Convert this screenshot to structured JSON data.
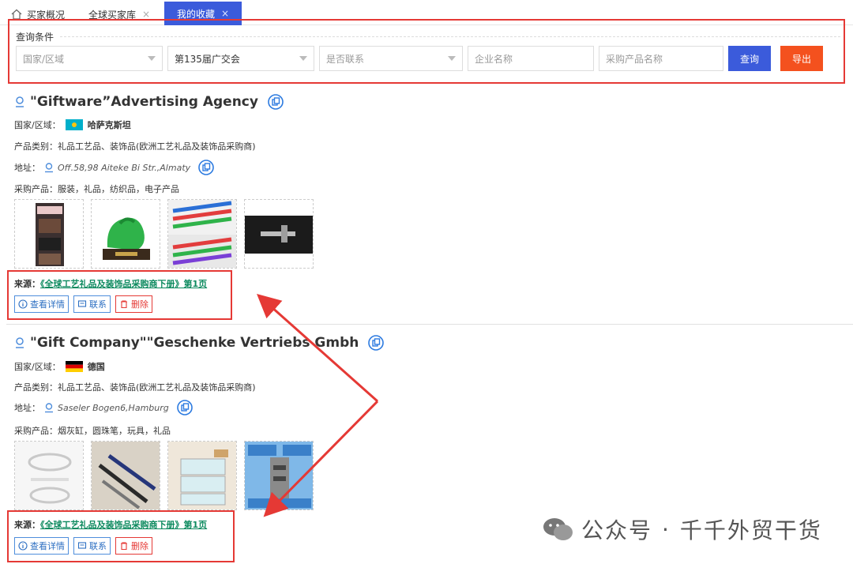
{
  "tabs": [
    {
      "label": "买家概况"
    },
    {
      "label": "全球买家库",
      "close": "×"
    },
    {
      "label": "我的收藏",
      "close": "×"
    }
  ],
  "query": {
    "title": "查询条件",
    "region_placeholder": "国家/区域",
    "fair_value": "第135届广交会",
    "contact_placeholder": "是否联系",
    "company_placeholder": "企业名称",
    "product_placeholder": "采购产品名称",
    "search_label": "查询",
    "export_label": "导出"
  },
  "companies": [
    {
      "name": "\"Giftware”Advertising Agency",
      "region_label": "国家/区域：",
      "region": "哈萨克斯坦",
      "category": "产品类别：礼品工艺品、装饰品(欧洲工艺礼品及装饰品采购商)",
      "address_label": "地址：",
      "address": "Off.58,98 Aiteke Bi Str.,Almaty",
      "products": "采购产品：服装，礼品，纺织品，电子产品",
      "source_label": "来源：",
      "source_link": "《全球工艺礼品及装饰品采购商下册》第1页",
      "actions": {
        "detail": "查看详情",
        "contact": "联系",
        "delete": "删除"
      }
    },
    {
      "name": "\"Gift Company\"\"Geschenke Vertriebs Gmbh",
      "region_label": "国家/区域：",
      "region": "德国",
      "category": "产品类别：礼品工艺品、装饰品(欧洲工艺礼品及装饰品采购商)",
      "address_label": "地址：",
      "address": "Saseler Bogen6,Hamburg",
      "products": "采购产品：烟灰缸，圆珠笔，玩具，礼品",
      "source_label": "来源：",
      "source_link": "《全球工艺礼品及装饰品采购商下册》第1页",
      "actions": {
        "detail": "查看详情",
        "contact": "联系",
        "delete": "删除"
      }
    }
  ],
  "watermark": {
    "part1": "公众号",
    "dot": "·",
    "part2": "千千外贸干货"
  },
  "colors": {
    "primary": "#3b5bdb",
    "export": "#f4511e",
    "highlight": "#e53935",
    "link": "#0d8a5f"
  }
}
